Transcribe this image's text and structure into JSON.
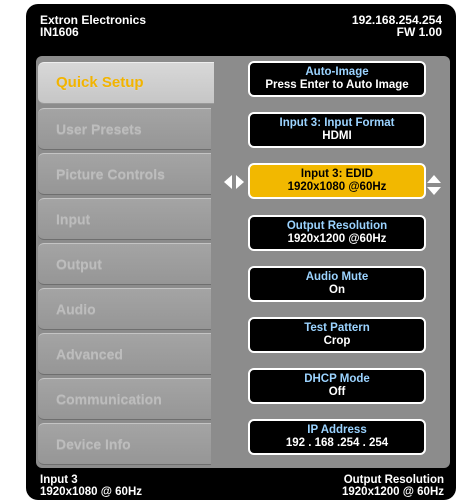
{
  "header": {
    "brand": "Extron Electronics",
    "model": "IN1606",
    "ip": "192.168.254.254",
    "firmware": "FW 1.00"
  },
  "tabs": [
    {
      "label": "Quick Setup",
      "active": true
    },
    {
      "label": "User Presets",
      "active": false
    },
    {
      "label": "Picture Controls",
      "active": false
    },
    {
      "label": "Input",
      "active": false
    },
    {
      "label": "Output",
      "active": false
    },
    {
      "label": "Audio",
      "active": false
    },
    {
      "label": "Advanced",
      "active": false
    },
    {
      "label": "Communication",
      "active": false
    },
    {
      "label": "Device Info",
      "active": false
    }
  ],
  "settings": [
    {
      "title": "Auto-Image",
      "value": "Press Enter to Auto Image"
    },
    {
      "title": "Input 3: Input Format",
      "value": "HDMI"
    },
    {
      "title": "Input 3: EDID",
      "value": "1920x1080 @60Hz",
      "selected": true
    },
    {
      "title": "Output Resolution",
      "value": "1920x1200 @60Hz"
    },
    {
      "title": "Audio Mute",
      "value": "On"
    },
    {
      "title": "Test Pattern",
      "value": "Crop"
    },
    {
      "title": "DHCP Mode",
      "value": "Off"
    },
    {
      "title": "IP Address",
      "value": "192 . 168 .254 . 254"
    }
  ],
  "footer": {
    "input_label": "Input 3",
    "input_value": "1920x1080 @ 60Hz",
    "output_label": "Output Resolution",
    "output_value": "1920x1200 @ 60Hz"
  },
  "colors": {
    "accent": "#f2b800",
    "setting_title": "#9bd3ff",
    "active_tab_text": "#f2b400"
  },
  "icons": {
    "left_right": "left-right-arrow-icon",
    "up_down": "up-down-arrow-icon"
  }
}
